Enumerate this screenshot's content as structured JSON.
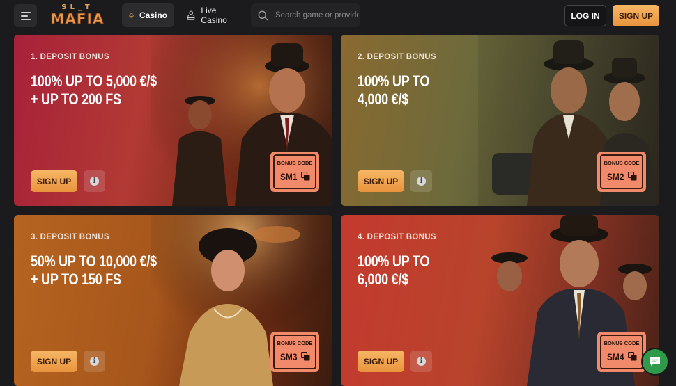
{
  "header": {
    "logo_top": "SL_T",
    "logo_main": "MAFIA",
    "tab_casino": "Casino",
    "tab_live": "Live Casino",
    "search_placeholder": "Search game or provider",
    "login": "LOG IN",
    "signup": "SIGN UP"
  },
  "cards": [
    {
      "label": "1. DEPOSIT BONUS",
      "title_line1": "100% UP TO 5,000 €/$",
      "title_line2": "+ UP TO 200 FS",
      "signup": "SIGN UP",
      "bonus_label": "BONUS CODE",
      "code": "SM1"
    },
    {
      "label": "2. DEPOSIT BONUS",
      "title_line1": "100% UP TO",
      "title_line2": "4,000 €/$",
      "signup": "SIGN UP",
      "bonus_label": "BONUS CODE",
      "code": "SM2"
    },
    {
      "label": "3. DEPOSIT BONUS",
      "title_line1": "50% UP TO 10,000 €/$",
      "title_line2": "+ UP TO 150 FS",
      "signup": "SIGN UP",
      "bonus_label": "BONUS CODE",
      "code": "SM3"
    },
    {
      "label": "4. DEPOSIT BONUS",
      "title_line1": "100% UP TO",
      "title_line2": "6,000 €/$",
      "signup": "SIGN UP",
      "bonus_label": "BONUS CODE",
      "code": "SM4"
    }
  ],
  "colors": {
    "accent": "#f0a550",
    "bonus_box": "#f18a6a",
    "background": "#1b1b1d"
  }
}
